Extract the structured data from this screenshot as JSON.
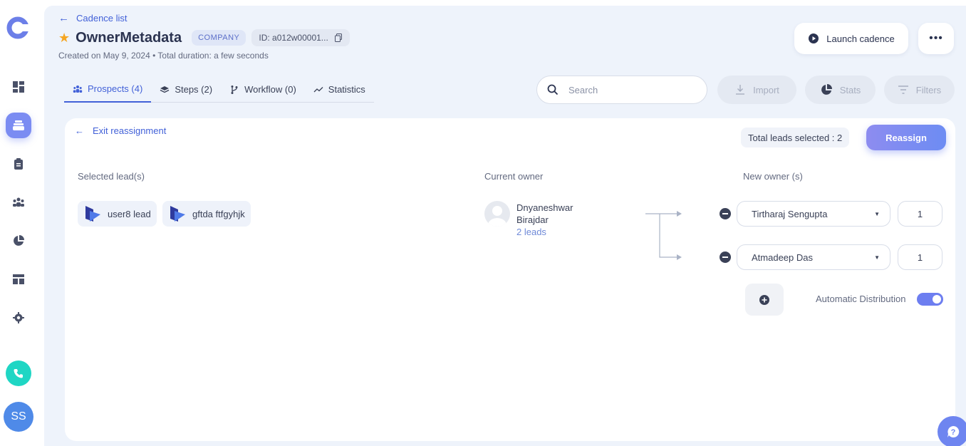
{
  "sidebar": {
    "items": [
      {
        "name": "dashboard-icon",
        "active": false
      },
      {
        "name": "cadences-icon",
        "active": true
      },
      {
        "name": "clipboard-icon",
        "active": false
      },
      {
        "name": "people-icon",
        "active": false
      },
      {
        "name": "pie-chart-icon",
        "active": false
      },
      {
        "name": "layout-icon",
        "active": false
      },
      {
        "name": "gear-icon",
        "active": false
      }
    ],
    "avatar_initials": "SS"
  },
  "header": {
    "back_label": "Cadence list",
    "title": "OwnerMetadata",
    "badge": "COMPANY",
    "id_label": "ID: a012w00001...",
    "subtitle": "Created on May 9, 2024 • Total duration: a few seconds",
    "launch_label": "Launch cadence",
    "more_label": "•••"
  },
  "tabs": [
    {
      "label": "Prospects (4)",
      "icon": "people-icon",
      "active": true
    },
    {
      "label": "Steps (2)",
      "icon": "layers-icon",
      "active": false
    },
    {
      "label": "Workflow (0)",
      "icon": "branch-icon",
      "active": false
    },
    {
      "label": "Statistics",
      "icon": "trend-icon",
      "active": false
    }
  ],
  "toolbar": {
    "search_placeholder": "Search",
    "import_label": "Import",
    "stats_label": "Stats",
    "filters_label": "Filters"
  },
  "reassign": {
    "exit_label": "Exit reassignment",
    "total_label": "Total leads selected : 2",
    "button_label": "Reassign",
    "selected_heading": "Selected lead(s)",
    "current_heading": "Current owner",
    "new_heading": "New owner (s)",
    "leads": [
      {
        "name": "user8 lead"
      },
      {
        "name": "gftda ftfgyhjk"
      }
    ],
    "current_owner": {
      "name": "Dnyaneshwar Birajdar",
      "leads": "2 leads"
    },
    "new_owners": [
      {
        "name": "Tirtharaj Sengupta",
        "qty": "1"
      },
      {
        "name": "Atmadeep Das",
        "qty": "1"
      }
    ],
    "auto_distribution_label": "Automatic Distribution",
    "auto_distribution_on": true
  },
  "colors": {
    "accent": "#4261d8",
    "primary_gradient_start": "#8d8cf0",
    "primary_gradient_end": "#6d8cf3",
    "phone": "#1fd6c4",
    "avatar": "#4f8ae8"
  }
}
